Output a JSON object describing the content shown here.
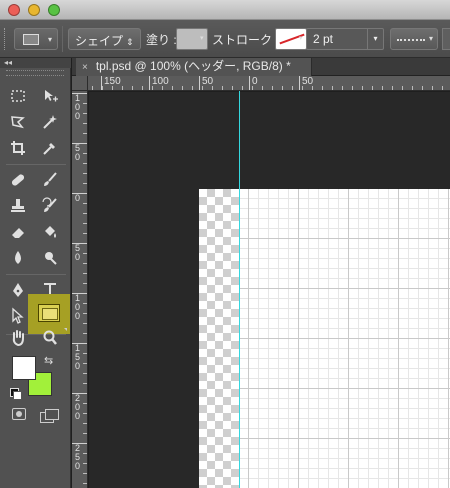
{
  "options_bar": {
    "mode_label": "シェイプ",
    "fill_label": "塗り :",
    "stroke_label": "ストローク :",
    "stroke_width": "2 pt"
  },
  "document": {
    "tab_title": "tpl.psd @ 100% (ヘッダー, RGB/8) *",
    "close_glyph": "×"
  },
  "rulers": {
    "horizontal": [
      "150",
      "100",
      "50",
      "0",
      "50"
    ],
    "vertical": [
      "1\n0\n0",
      "5\n0",
      "0",
      "5\n0",
      "1\n0\n0",
      "1\n5\n0",
      "2\n0\n0",
      "2\n5\n0"
    ]
  },
  "toolbox": {
    "collapse_glyph": "◂◂",
    "active_tool": "rectangle-tool",
    "foreground_color": "#ffffff",
    "background_color": "#a2f03a"
  },
  "colors": {
    "guide": "#35d7df",
    "active_highlight": "#a6a024"
  }
}
